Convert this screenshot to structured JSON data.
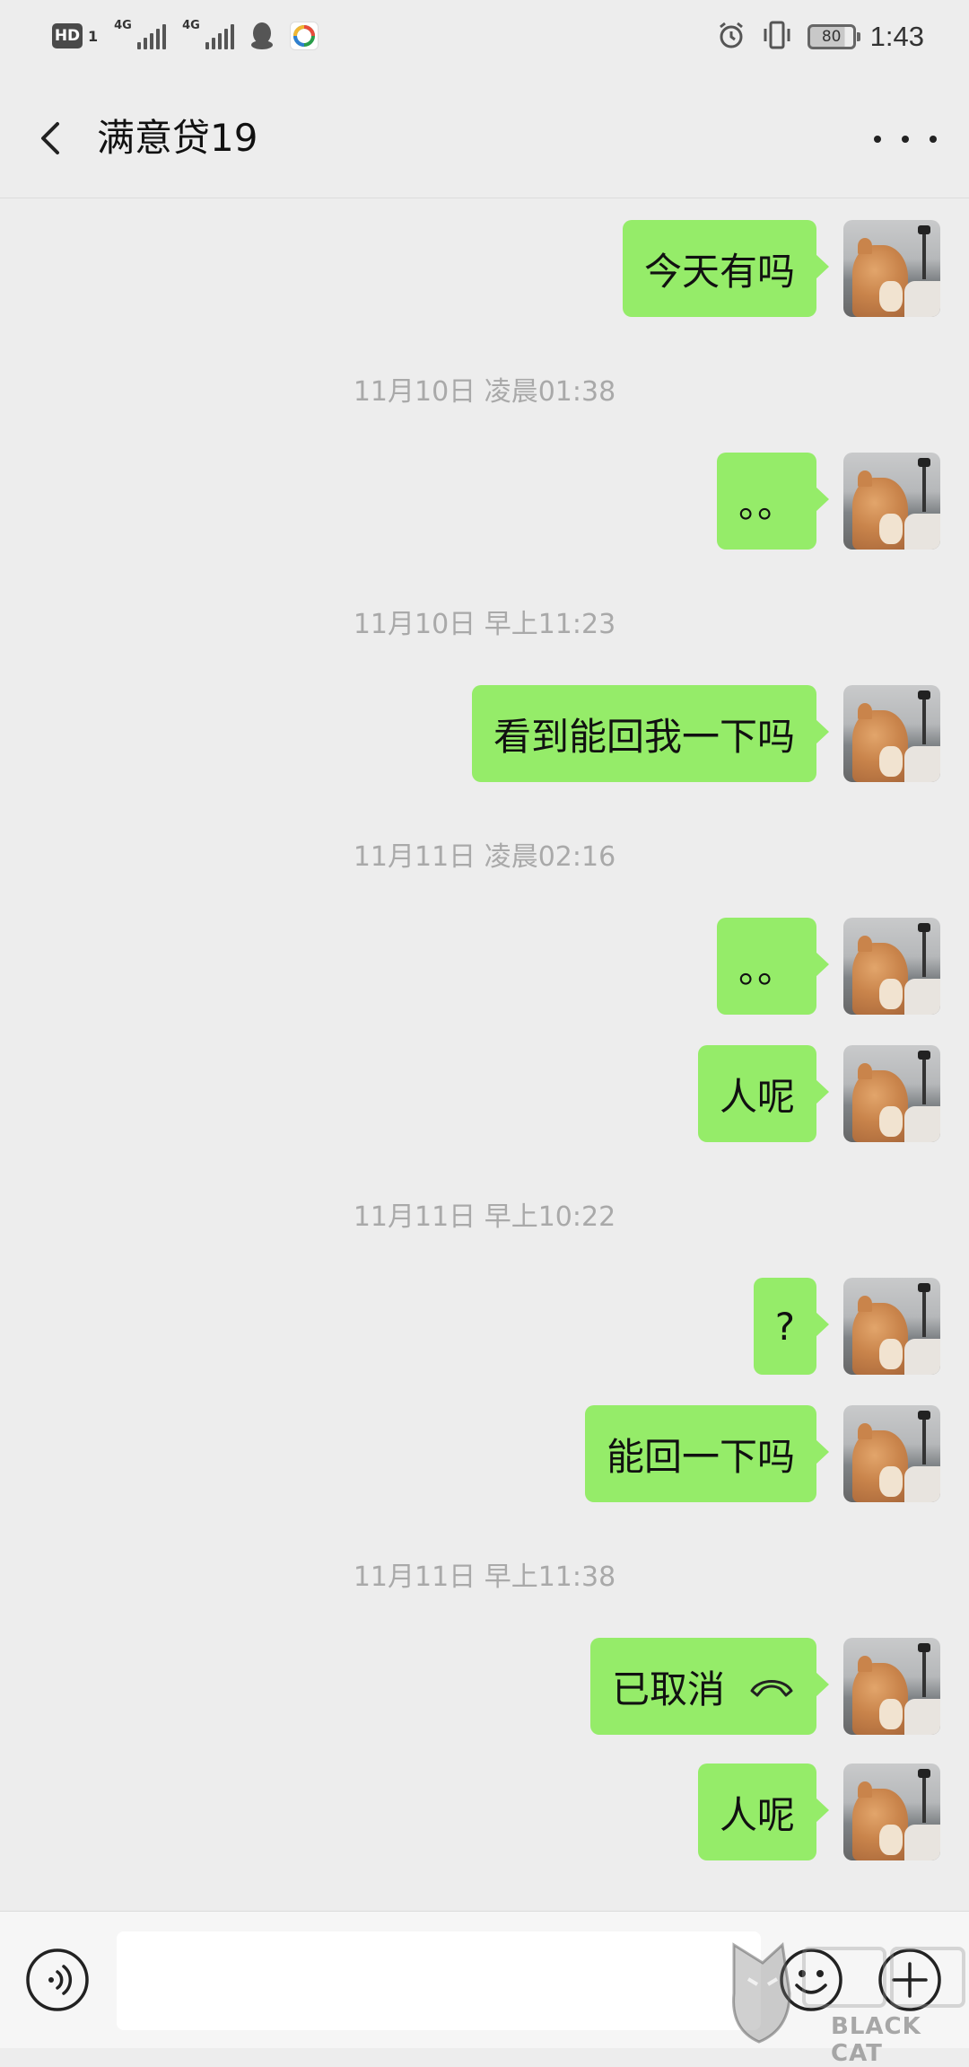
{
  "status_bar": {
    "hd": "HD",
    "sim": "1",
    "net1": "4G",
    "net2": "4G",
    "battery": "80",
    "time": "1:43"
  },
  "header": {
    "title": "满意贷19",
    "back_icon": "chevron-left-icon",
    "more_icon": "more-dots-icon"
  },
  "messages": [
    {
      "type": "sent",
      "text": "今天有吗"
    },
    {
      "type": "time",
      "text": "11月10日 凌晨01:38"
    },
    {
      "type": "sent",
      "text": "。。"
    },
    {
      "type": "time",
      "text": "11月10日 早上11:23"
    },
    {
      "type": "sent",
      "text": "看到能回我一下吗"
    },
    {
      "type": "time",
      "text": "11月11日 凌晨02:16"
    },
    {
      "type": "sent",
      "text": "。。"
    },
    {
      "type": "sent",
      "text": "人呢"
    },
    {
      "type": "time",
      "text": "11月11日 早上10:22"
    },
    {
      "type": "sent",
      "text": "?"
    },
    {
      "type": "sent",
      "text": "能回一下吗"
    },
    {
      "type": "time",
      "text": "11月11日 早上11:38"
    },
    {
      "type": "call",
      "text": "已取消"
    },
    {
      "type": "sent",
      "text": "人呢"
    }
  ],
  "input_bar": {
    "voice_icon": "voice-icon",
    "emoji_icon": "emoji-icon",
    "plus_icon": "plus-icon",
    "input_value": ""
  },
  "watermark": {
    "text": "BLACK CAT"
  },
  "colors": {
    "bubble": "#95ec69",
    "background": "#ededed",
    "timestamp": "#a9a9a9"
  }
}
